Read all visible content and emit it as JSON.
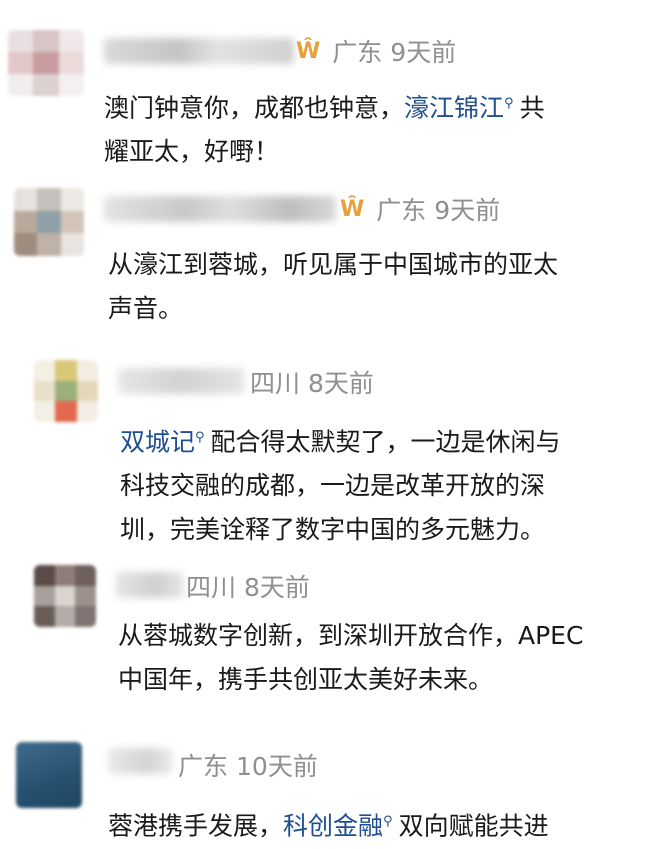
{
  "comments": [
    {
      "location": "广东",
      "time": "9天前",
      "badge_icon": "medal-icon",
      "text_before": "澳门钟意你，成都也钟意，",
      "topic": "濠江锦江",
      "text_mid": "共",
      "text_line2": "耀亚太，好嘢！"
    },
    {
      "location": "广东",
      "time": "9天前",
      "badge_icon": "medal-icon",
      "text_line1": "从濠江到蓉城，听见属于中国城市的亚太",
      "text_line2": "声音。"
    },
    {
      "location": "四川",
      "time": "8天前",
      "topic": "双城记",
      "text_line1_after": "配合得太默契了，一边是休闲与",
      "text_line2": "科技交融的成都，一边是改革开放的深",
      "text_line3": "圳，完美诠释了数字中国的多元魅力。"
    },
    {
      "location": "四川",
      "time": "8天前",
      "text_line1": "从蓉城数字创新，到深圳开放合作，APEC",
      "text_line2": "中国年，携手共创亚太美好未来。"
    },
    {
      "location": "广东",
      "time": "10天前",
      "text_before": "蓉港携手发展，",
      "topic": "科创金融",
      "text_after": "双向赋能共进"
    }
  ],
  "colors": {
    "topic": "#1f4f8f",
    "meta": "#8f8f8f",
    "medal": "#e8a13a"
  },
  "icons": {
    "topic_search": "search-icon",
    "medal": "medal-icon"
  }
}
